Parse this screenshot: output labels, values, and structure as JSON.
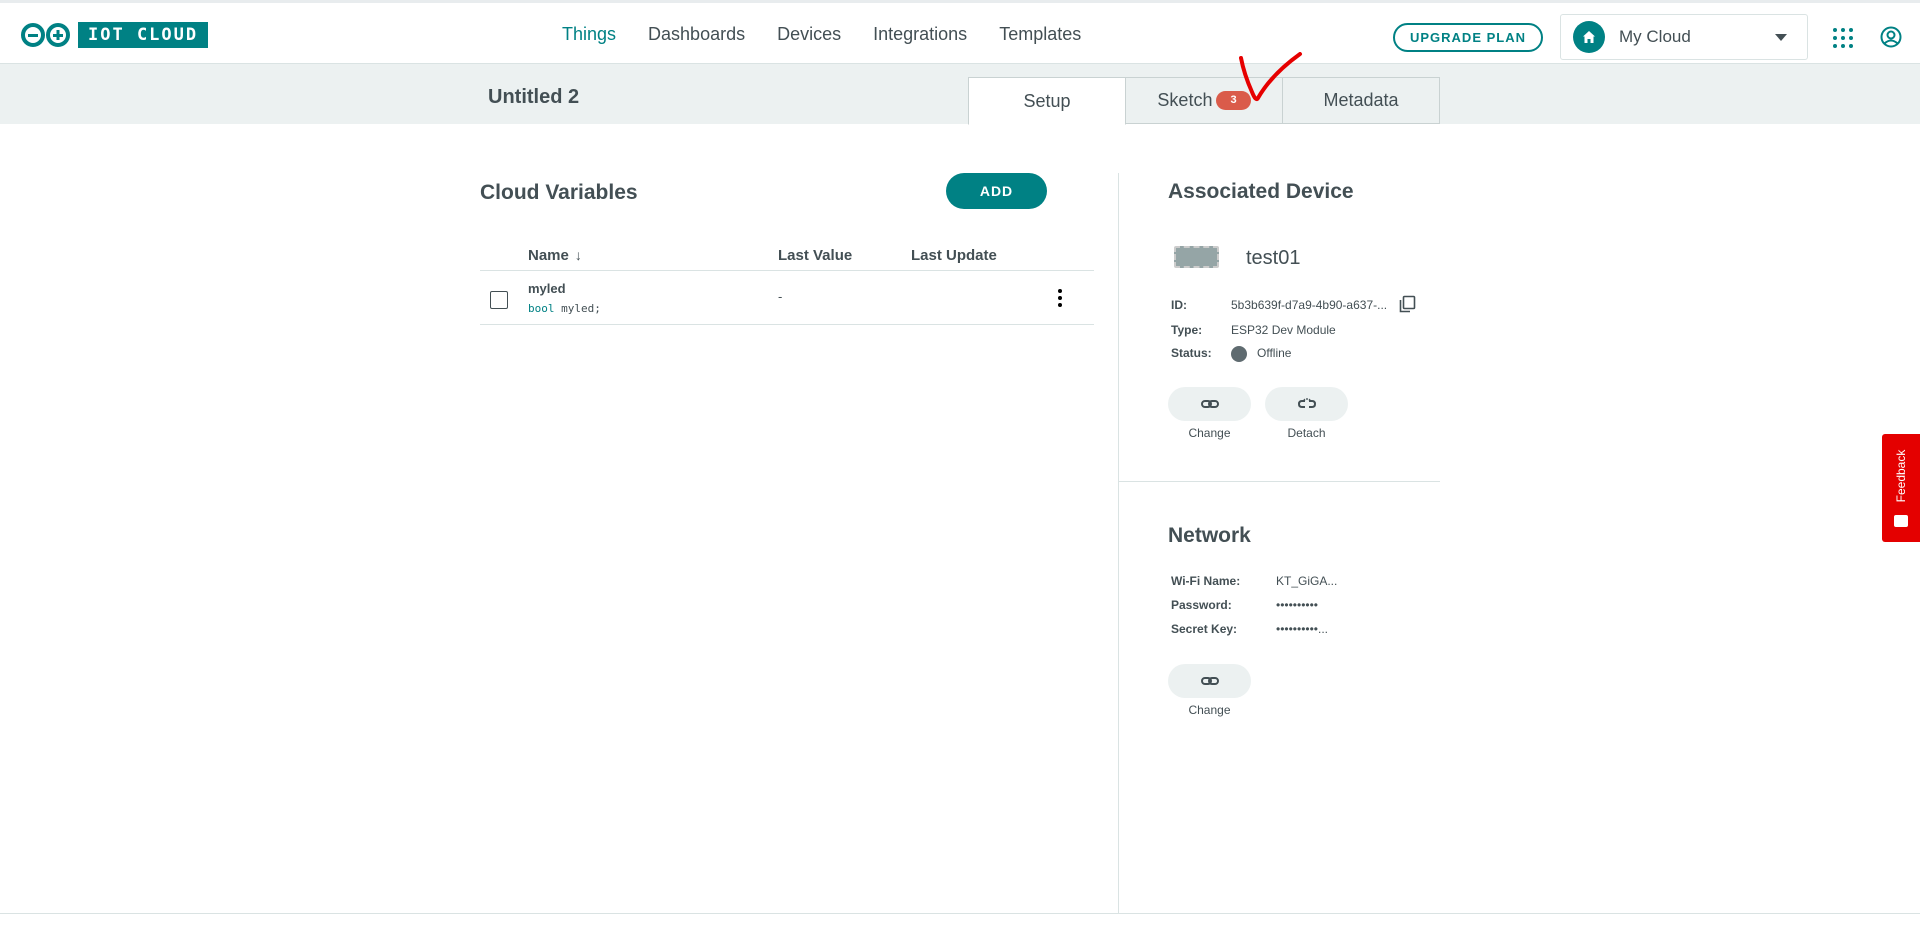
{
  "app": {
    "logo_text": "IOT CLOUD"
  },
  "nav": {
    "items": [
      {
        "label": "Things",
        "active": true
      },
      {
        "label": "Dashboards",
        "active": false
      },
      {
        "label": "Devices",
        "active": false
      },
      {
        "label": "Integrations",
        "active": false
      },
      {
        "label": "Templates",
        "active": false
      }
    ],
    "upgrade_label": "UPGRADE PLAN",
    "space_name": "My Cloud"
  },
  "thing": {
    "title": "Untitled 2",
    "tabs": [
      {
        "label": "Setup",
        "active": true
      },
      {
        "label": "Sketch",
        "badge": "3"
      },
      {
        "label": "Metadata"
      }
    ]
  },
  "variables": {
    "title": "Cloud Variables",
    "add_label": "ADD",
    "columns": [
      "Name",
      "Last Value",
      "Last Update"
    ],
    "rows": [
      {
        "name": "myled",
        "type": "bool",
        "decl_name": "myled;",
        "last_value": "-",
        "last_update": ""
      }
    ]
  },
  "device": {
    "title": "Associated Device",
    "name": "test01",
    "id_label": "ID:",
    "id_value": "5b3b639f-d7a9-4b90-a637-...",
    "type_label": "Type:",
    "type_value": "ESP32 Dev Module",
    "status_label": "Status:",
    "status_value": "Offline",
    "change_label": "Change",
    "detach_label": "Detach"
  },
  "network": {
    "title": "Network",
    "wifi_label": "Wi-Fi Name:",
    "wifi_value": "KT_GiGA...",
    "password_label": "Password:",
    "password_value": "••••••••••",
    "secret_label": "Secret Key:",
    "secret_value": "••••••••••...",
    "change_label": "Change"
  },
  "feedback": {
    "label": "Feedback"
  },
  "colors": {
    "accent": "#008184",
    "badge": "#da5b4a",
    "feedback": "#e40000",
    "annotation": "#e60000"
  }
}
